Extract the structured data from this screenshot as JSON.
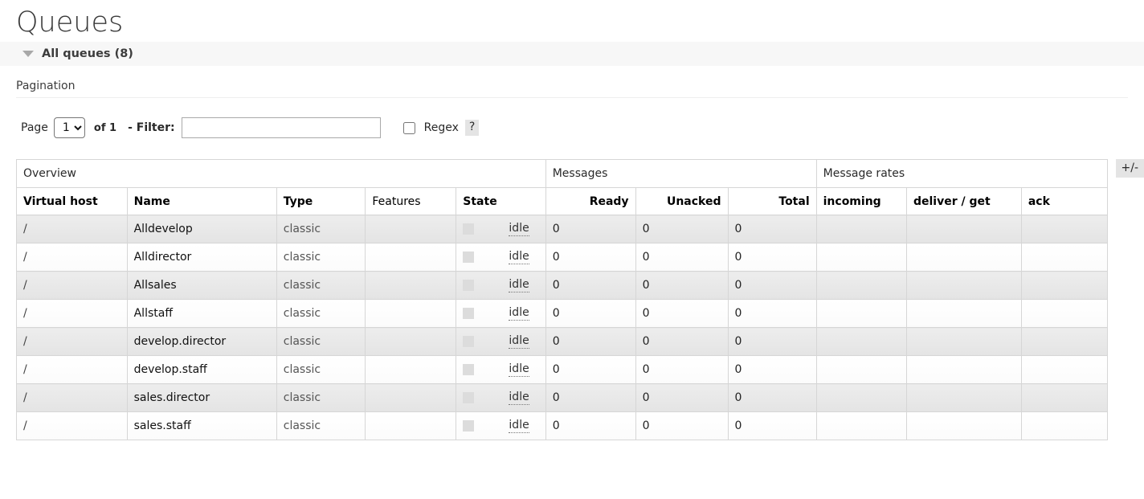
{
  "page": {
    "title": "Queues"
  },
  "section": {
    "label": "All queues (8)",
    "triangle_icon": "caret-down-icon"
  },
  "pagination": {
    "heading": "Pagination",
    "page_label": "Page",
    "page_value": "1",
    "page_options": [
      "1"
    ],
    "of_label": "of 1",
    "filter_label": "- Filter:",
    "filter_value": "",
    "filter_placeholder": "",
    "regex_label": "Regex",
    "regex_checked": false,
    "help_label": "?"
  },
  "table": {
    "groups": [
      {
        "label": "Overview",
        "span": 5
      },
      {
        "label": "Messages",
        "span": 3
      },
      {
        "label": "Message rates",
        "span": 3
      }
    ],
    "columns": [
      {
        "label": "Virtual host",
        "bold": true,
        "align": "left"
      },
      {
        "label": "Name",
        "bold": true,
        "align": "left"
      },
      {
        "label": "Type",
        "bold": true,
        "align": "left"
      },
      {
        "label": "Features",
        "bold": false,
        "align": "left"
      },
      {
        "label": "State",
        "bold": true,
        "align": "left"
      },
      {
        "label": "Ready",
        "bold": true,
        "align": "right"
      },
      {
        "label": "Unacked",
        "bold": true,
        "align": "right"
      },
      {
        "label": "Total",
        "bold": true,
        "align": "right"
      },
      {
        "label": "incoming",
        "bold": true,
        "align": "left"
      },
      {
        "label": "deliver / get",
        "bold": true,
        "align": "left"
      },
      {
        "label": "ack",
        "bold": true,
        "align": "left"
      }
    ],
    "rows": [
      {
        "vhost": "/",
        "name": "Alldevelop",
        "type": "classic",
        "features": "",
        "state": "idle",
        "ready": "0",
        "unacked": "0",
        "total": "0",
        "incoming": "",
        "deliver_get": "",
        "ack": ""
      },
      {
        "vhost": "/",
        "name": "Alldirector",
        "type": "classic",
        "features": "",
        "state": "idle",
        "ready": "0",
        "unacked": "0",
        "total": "0",
        "incoming": "",
        "deliver_get": "",
        "ack": ""
      },
      {
        "vhost": "/",
        "name": "Allsales",
        "type": "classic",
        "features": "",
        "state": "idle",
        "ready": "0",
        "unacked": "0",
        "total": "0",
        "incoming": "",
        "deliver_get": "",
        "ack": ""
      },
      {
        "vhost": "/",
        "name": "Allstaff",
        "type": "classic",
        "features": "",
        "state": "idle",
        "ready": "0",
        "unacked": "0",
        "total": "0",
        "incoming": "",
        "deliver_get": "",
        "ack": ""
      },
      {
        "vhost": "/",
        "name": "develop.director",
        "type": "classic",
        "features": "",
        "state": "idle",
        "ready": "0",
        "unacked": "0",
        "total": "0",
        "incoming": "",
        "deliver_get": "",
        "ack": ""
      },
      {
        "vhost": "/",
        "name": "develop.staff",
        "type": "classic",
        "features": "",
        "state": "idle",
        "ready": "0",
        "unacked": "0",
        "total": "0",
        "incoming": "",
        "deliver_get": "",
        "ack": ""
      },
      {
        "vhost": "/",
        "name": "sales.director",
        "type": "classic",
        "features": "",
        "state": "idle",
        "ready": "0",
        "unacked": "0",
        "total": "0",
        "incoming": "",
        "deliver_get": "",
        "ack": ""
      },
      {
        "vhost": "/",
        "name": "sales.staff",
        "type": "classic",
        "features": "",
        "state": "idle",
        "ready": "0",
        "unacked": "0",
        "total": "0",
        "incoming": "",
        "deliver_get": "",
        "ack": ""
      }
    ],
    "toggle_columns_label": "+/-"
  },
  "colors": {
    "section_bar_bg": "#f7f7f7",
    "row_odd_bg": "#ededed",
    "row_even_bg": "#ffffff",
    "table_border": "#d6d6d6",
    "state_box": "#dcdcdc",
    "button_bg": "#e4e4e4",
    "title_text": "#3a3a3a"
  }
}
